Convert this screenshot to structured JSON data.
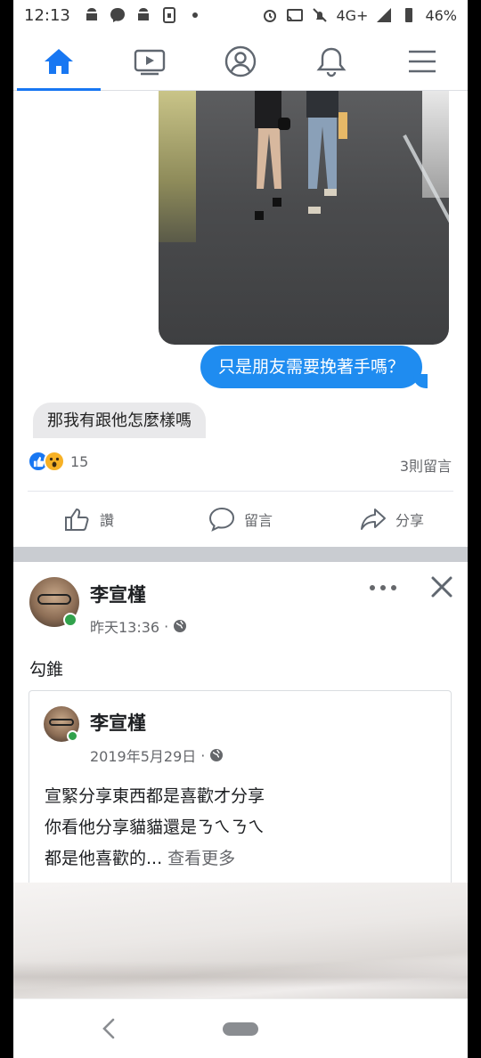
{
  "status_bar": {
    "time": "12:13",
    "network": "4G+",
    "battery": "46%"
  },
  "tabs": [
    {
      "name": "home-icon",
      "active": true
    },
    {
      "name": "watch-icon",
      "active": false
    },
    {
      "name": "profile-icon",
      "active": false
    },
    {
      "name": "bell-icon",
      "active": false
    },
    {
      "name": "menu-icon",
      "active": false
    }
  ],
  "post1": {
    "chat_outgoing": "只是朋友需要挽著手嗎？",
    "chat_incoming": "那我有跟他怎麼樣嗎",
    "reaction_count": "15",
    "comment_count": "3則留言",
    "actions": {
      "like": "讚",
      "comment": "留言",
      "share": "分享"
    }
  },
  "post2": {
    "author": "李宣槿",
    "time": "昨天13:36",
    "text": "勾錐",
    "shared": {
      "author": "李宣槿",
      "date": "2019年5月29日",
      "line1": "宣緊分享東西都是喜歡才分享",
      "line2": "你看他分享貓貓還是ㄋㄟㄋㄟ",
      "line3": "都是他喜歡的...",
      "see_more": "查看更多"
    }
  },
  "colors": {
    "accent": "#1877f2",
    "bubble": "#1f8cf0",
    "presence": "#31a24c"
  }
}
